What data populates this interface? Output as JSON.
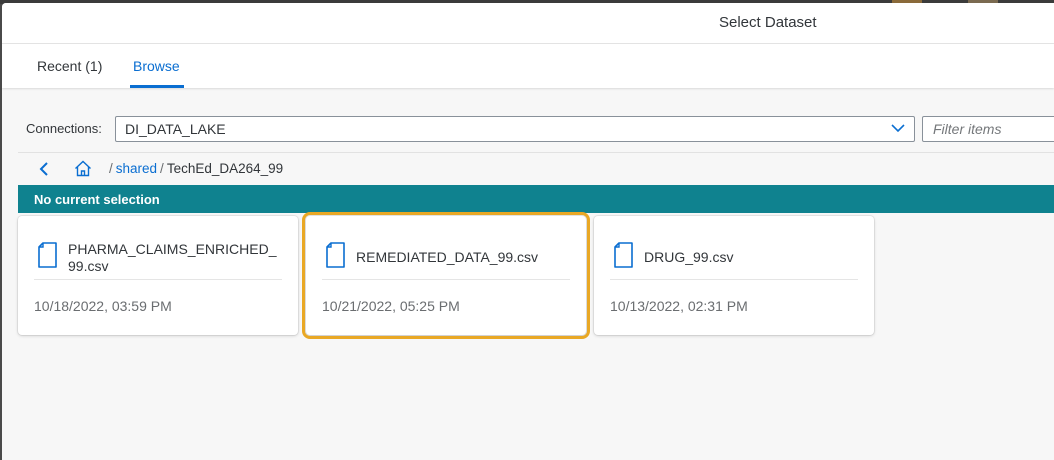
{
  "dialog": {
    "title": "Select Dataset"
  },
  "tabs": [
    {
      "label": "Recent (1)"
    },
    {
      "label": "Browse",
      "selected": true
    }
  ],
  "connections": {
    "label": "Connections:",
    "value": "DI_DATA_LAKE"
  },
  "filter": {
    "placeholder": "Filter items"
  },
  "breadcrumb": {
    "sep": "/",
    "parts": [
      "shared",
      "TechEd_DA264_99"
    ]
  },
  "selection_bar": {
    "text": "No current selection"
  },
  "files": [
    {
      "name": "PHARMA_CLAIMS_ENRICHED_99.csv",
      "date": "10/18/2022, 03:59 PM",
      "icon": "file-icon"
    },
    {
      "name": "REMEDIATED_DATA_99.csv",
      "date": "10/21/2022, 05:25 PM",
      "icon": "file-icon",
      "highlighted": true
    },
    {
      "name": "DRUG_99.csv",
      "date": "10/13/2022, 02:31 PM",
      "icon": "file-icon"
    }
  ],
  "colors": {
    "accent": "#0a6ed1",
    "selection_bar": "#0f828f",
    "highlight": "#e9a825"
  }
}
